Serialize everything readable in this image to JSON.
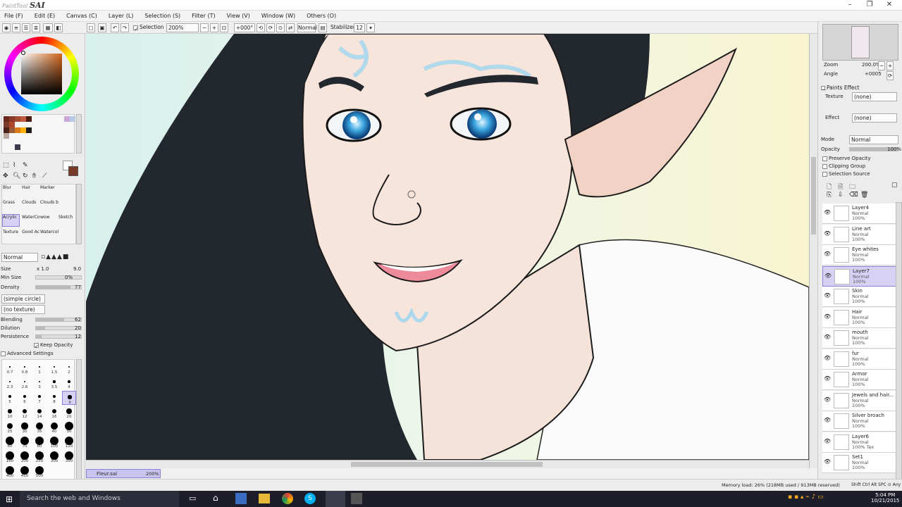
{
  "app": {
    "logo_small": "PaintTool",
    "logo": "SAI"
  },
  "menu": [
    "File (F)",
    "Edit (E)",
    "Canvas (C)",
    "Layer (L)",
    "Selection (S)",
    "Filter (T)",
    "View (V)",
    "Window (W)",
    "Others (O)"
  ],
  "toolbar": {
    "selection_label": "Selection",
    "zoom": "200%",
    "angle": "+000°",
    "mode": "Normal",
    "stabilizer_label": "Stabilizer",
    "stabilizer_value": "12"
  },
  "tools": {
    "brushes": [
      "Blur",
      "Hair",
      "Marker",
      "Grass",
      "Clouds",
      "Clouds b",
      "Acrylic",
      "WaterCo",
      "wow",
      "Sketch",
      "Texture",
      "Good Ac",
      "Watercol"
    ],
    "blend_mode": "Normal",
    "size_label": "Size",
    "size_mult": "x 1.0",
    "size_value": "9.0",
    "minsize_label": "Min Size",
    "minsize_value": "0%",
    "density_label": "Density",
    "density_value": "77",
    "shape": "(simple circle)",
    "texture": "(no texture)",
    "blending_label": "Blending",
    "blending_value": "62",
    "dilution_label": "Dilution",
    "dilution_value": "20",
    "persistence_label": "Persistence",
    "persistence_value": "12",
    "keep_opacity": "Keep Opacity",
    "advanced": "Advanced Settings",
    "brush_sizes": [
      "0.7",
      "0.8",
      "1",
      "1.5",
      "2",
      "2.3",
      "2.6",
      "3",
      "3.5",
      "4",
      "5",
      "6",
      "7",
      "8",
      "9",
      "10",
      "12",
      "14",
      "16",
      "20",
      "25",
      "30",
      "35",
      "40",
      "50",
      "60",
      "70",
      "80",
      "100",
      "120",
      "160",
      "200",
      "250",
      "300",
      "350",
      "400",
      "450",
      "500"
    ]
  },
  "navigator": {
    "zoom_label": "Zoom",
    "zoom_value": "200.0%",
    "angle_label": "Angle",
    "angle_value": "+0005"
  },
  "paint_effect": {
    "title": "Paints Effect",
    "texture_label": "Texture",
    "texture_value": "(none)",
    "effect_label": "Effect",
    "effect_value": "(none)",
    "mode_label": "Mode",
    "mode_value": "Normal",
    "opacity_label": "Opacity",
    "opacity_value": "100%",
    "preserve_opacity": "Preserve Opacity",
    "clipping_group": "Clipping Group",
    "selection_source": "Selection Source"
  },
  "layers": [
    {
      "name": "Layer4",
      "mode": "Normal",
      "opacity": "100%"
    },
    {
      "name": "Line art",
      "mode": "Normal",
      "opacity": "100%"
    },
    {
      "name": "Eye whites",
      "mode": "Normal",
      "opacity": "100%"
    },
    {
      "name": "Layer7",
      "mode": "Normal",
      "opacity": "100%"
    },
    {
      "name": "Skin",
      "mode": "Normal",
      "opacity": "100%"
    },
    {
      "name": "Hair",
      "mode": "Normal",
      "opacity": "100%"
    },
    {
      "name": "mouth",
      "mode": "Normal",
      "opacity": "100%"
    },
    {
      "name": "fur",
      "mode": "Normal",
      "opacity": "100%"
    },
    {
      "name": "Armor",
      "mode": "Normal",
      "opacity": "100%"
    },
    {
      "name": "Jewels and hair...",
      "mode": "Normal",
      "opacity": "100%"
    },
    {
      "name": "Silver broach",
      "mode": "Normal",
      "opacity": "100%"
    },
    {
      "name": "Layer6",
      "mode": "Normal",
      "opacity": "100% Tex"
    },
    {
      "name": "Set1",
      "mode": "Normal",
      "opacity": "100%"
    }
  ],
  "document_tab": {
    "name": "Fleur.sai",
    "zoom": "200%"
  },
  "status": {
    "memory": "Memory load: 26% (218MB used / 913MB reserved)",
    "keys": "Shift Ctrl Alt SPC ⊙ Any"
  },
  "taskbar": {
    "search_placeholder": "Search the web and Windows",
    "time": "5:04 PM",
    "date": "10/21/2015"
  },
  "colors": {
    "accent": "#8a82d9",
    "taskbar": "#1d1e2a",
    "hair": "#23272e",
    "skin": "#f5dfd4"
  }
}
